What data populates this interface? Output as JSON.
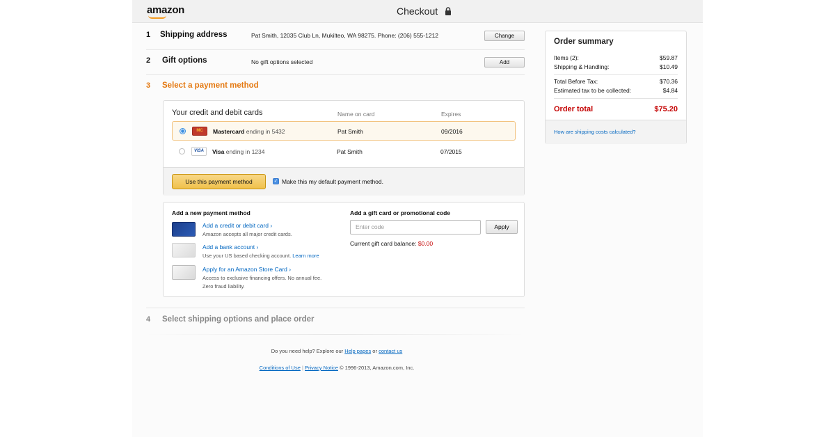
{
  "header": {
    "logo_text": "amazon",
    "title": "Checkout"
  },
  "steps": [
    {
      "number": "1",
      "title": "Shipping address",
      "detail": "Pat Smith, 12035 Club Ln, Mukilteo, WA 98275. Phone: (206) 555-1212",
      "button": "Change"
    },
    {
      "number": "2",
      "title": "Gift options",
      "detail": "No gift options selected",
      "button": "Add"
    },
    {
      "number": "3",
      "title": "Select a payment method"
    },
    {
      "number": "4",
      "title": "Select shipping options and place order"
    }
  ],
  "cards": {
    "heading": "Your credit and debit cards",
    "col_name": "Name on card",
    "col_expires": "Expires",
    "rows": [
      {
        "logo": "MC",
        "brand": "Mastercard",
        "ending": "ending in 5432",
        "name": "Pat Smith",
        "expires": "09/2016",
        "selected": true
      },
      {
        "logo": "VISA",
        "brand": "Visa",
        "ending": "ending in 1234",
        "name": "Pat Smith",
        "expires": "07/2015",
        "selected": false
      }
    ],
    "use_button": "Use this payment method",
    "default_label": "Make this my default payment method.",
    "default_checked": true
  },
  "add_payment": {
    "heading": "Add a new payment method",
    "items": [
      {
        "link": "Add a credit or debit card",
        "sub": "Amazon accepts all major credit cards."
      },
      {
        "link": "Add a bank account",
        "sub": "Use your US based checking account.",
        "sub_link": "Learn more"
      },
      {
        "link": "Apply for an Amazon Store Card",
        "sub": "Access to exclusive financing offers. No annual fee.",
        "sub2": "Zero fraud liability."
      }
    ]
  },
  "gift_card": {
    "heading": "Add a gift card or promotional code",
    "placeholder": "Enter code",
    "apply": "Apply",
    "balance_label": "Current gift card balance:",
    "balance_value": "$0.00"
  },
  "summary": {
    "title": "Order summary",
    "items_label": "Items (2):",
    "items_value": "$59.87",
    "shipping_label": "Shipping & Handling:",
    "shipping_value": "$10.49",
    "before_tax_label": "Total Before Tax:",
    "before_tax_value": "$70.36",
    "tax_label": "Estimated tax to be collected:",
    "tax_value": "$4.84",
    "total_label": "Order total",
    "total_value": "$75.20",
    "shipping_link": "How are shipping costs calculated?"
  },
  "footer": {
    "help_prefix": "Do you need help? Explore our",
    "help_link": "Help pages",
    "or": "or",
    "contact_link": "contact us",
    "conditions": "Conditions of Use",
    "separator": "|",
    "privacy": "Privacy Notice",
    "copyright": "© 1996-2013, Amazon.com, Inc."
  },
  "colors": {
    "accent_orange": "#e47911",
    "link_blue": "#0066c0",
    "total_red": "#c40000",
    "button_yellow": "#f0c14b"
  }
}
